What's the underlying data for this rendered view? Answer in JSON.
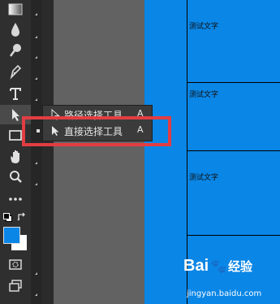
{
  "toolbar": {
    "tools": [
      {
        "name": "gradient-tool",
        "icon": "gradient-icon"
      },
      {
        "name": "blur-tool",
        "icon": "drop-icon"
      },
      {
        "name": "dodge-tool",
        "icon": "dodge-icon"
      },
      {
        "name": "pen-tool",
        "icon": "pen-icon"
      },
      {
        "name": "type-tool",
        "icon": "type-icon"
      },
      {
        "name": "path-selection-tool",
        "icon": "arrow-icon"
      },
      {
        "name": "rectangle-tool",
        "icon": "rectangle-icon"
      },
      {
        "name": "hand-tool",
        "icon": "hand-icon"
      },
      {
        "name": "zoom-tool",
        "icon": "zoom-icon"
      },
      {
        "name": "more-tools",
        "icon": "ellipsis-icon"
      }
    ],
    "foreground_color": "#0a86e6",
    "background_color": "#ffffff"
  },
  "flyout": {
    "items": [
      {
        "label": "路径选择工具",
        "shortcut": "A",
        "selected": false
      },
      {
        "label": "直接选择工具",
        "shortcut": "A",
        "selected": true
      }
    ]
  },
  "document": {
    "cells": [
      "测试文字",
      "测试文字",
      "测试文字",
      ""
    ],
    "background": "#0a86e6"
  },
  "watermark": {
    "brand": "Bai",
    "brand_suffix": "经验",
    "url": "jingyan.baidu.com"
  },
  "highlight_color": "#e13d43"
}
